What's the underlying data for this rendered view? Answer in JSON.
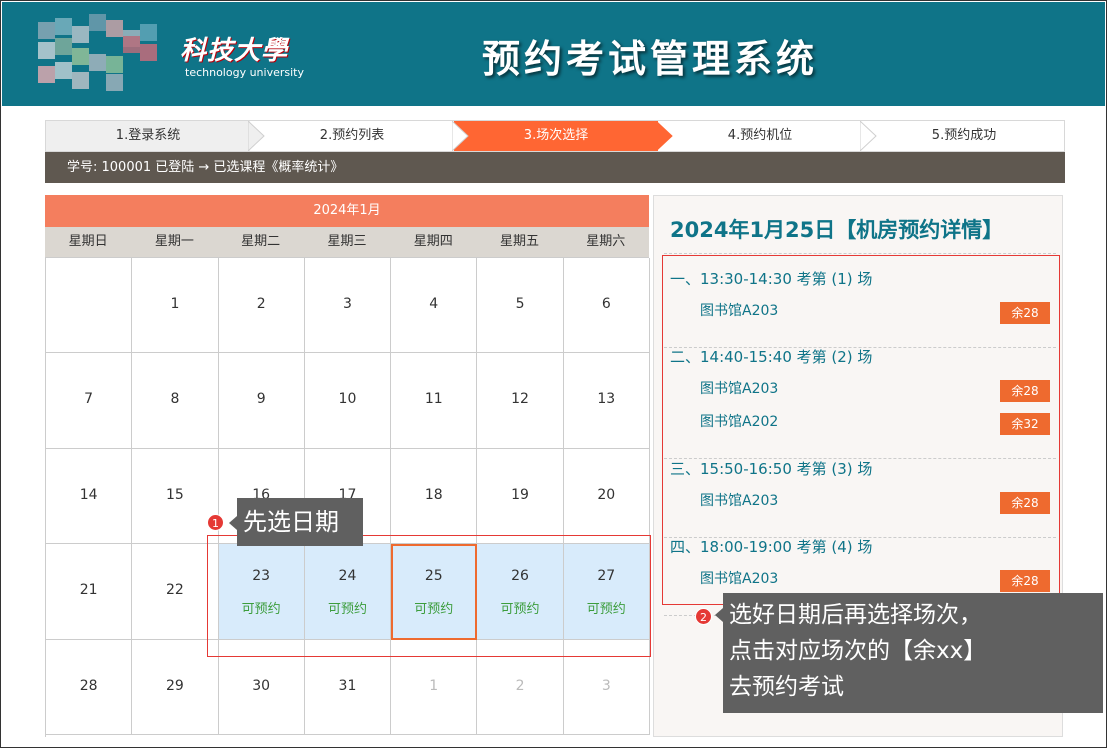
{
  "header": {
    "logo_cn": "科技大學",
    "logo_en": "technology university",
    "app_title": "预约考试管理系统",
    "mosaic_colors": [
      "#8aa8b6",
      "#79b1c0",
      "#b3c3cb",
      "#6f9cae",
      "#c8a3a8",
      "#a0b7c1",
      "#5fa6b8",
      "#c0d0d6",
      "#7fae9d",
      "#94c29a",
      "#b56c7a",
      "#c46c7b",
      "#a4b6bf",
      "#89c09a",
      "#bacfd5",
      "#d9a9b0",
      "#b8c2c8",
      "#9cb2bc"
    ]
  },
  "steps": [
    {
      "label": "1.登录系统",
      "active": false
    },
    {
      "label": "2.预约列表",
      "active": false
    },
    {
      "label": "3.场次选择",
      "active": true
    },
    {
      "label": "4.预约机位",
      "active": false
    },
    {
      "label": "5.预约成功",
      "active": false
    }
  ],
  "status_text": "学号: 100001 已登陆 → 已选课程《概率统计》",
  "calendar": {
    "month_label": "2024年1月",
    "weekdays": [
      "星期日",
      "星期一",
      "星期二",
      "星期三",
      "星期四",
      "星期五",
      "星期六"
    ],
    "available_label": "可预约",
    "weeks": [
      [
        "",
        "1",
        "2",
        "3",
        "4",
        "5",
        "6"
      ],
      [
        "7",
        "8",
        "9",
        "10",
        "11",
        "12",
        "13"
      ],
      [
        "14",
        "15",
        "16",
        "17",
        "18",
        "19",
        "20"
      ],
      [
        "21",
        "22",
        "23",
        "24",
        "25",
        "26",
        "27"
      ],
      [
        "28",
        "29",
        "30",
        "31",
        "1",
        "2",
        "3"
      ]
    ],
    "available_days": [
      "23",
      "24",
      "25",
      "26",
      "27"
    ],
    "selected_day": "25",
    "other_month_cells": [
      [
        4,
        4
      ],
      [
        4,
        5
      ],
      [
        4,
        6
      ]
    ]
  },
  "detail": {
    "title": "2024年1月25日【机房预约详情】",
    "sessions": [
      {
        "title": "一、13:30-14:30 考第 (1) 场",
        "rooms": [
          {
            "name": "图书馆A203",
            "remain": "余28"
          }
        ]
      },
      {
        "title": "二、14:40-15:40 考第 (2) 场",
        "rooms": [
          {
            "name": "图书馆A203",
            "remain": "余28"
          },
          {
            "name": "图书馆A202",
            "remain": "余32"
          }
        ]
      },
      {
        "title": "三、15:50-16:50 考第 (3) 场",
        "rooms": [
          {
            "name": "图书馆A203",
            "remain": "余28"
          }
        ]
      },
      {
        "title": "四、18:00-19:00 考第 (4) 场",
        "rooms": [
          {
            "name": "图书馆A203",
            "remain": "余28"
          }
        ]
      }
    ]
  },
  "annotations": {
    "tip1_num": "1",
    "tip1_text": "先选日期",
    "tip2_num": "2",
    "tip2_line1": "选好日期后再选择场次，",
    "tip2_line2": "点击对应场次的【余xx】",
    "tip2_line3": "去预约考试"
  },
  "colors": {
    "header_bg": "#0f7488",
    "active_step": "#ff6633",
    "calendar_header": "#f47e5e",
    "available_green": "#3c9d3c",
    "remain_badge": "#ee6a2f",
    "highlight_red": "#e53935"
  }
}
